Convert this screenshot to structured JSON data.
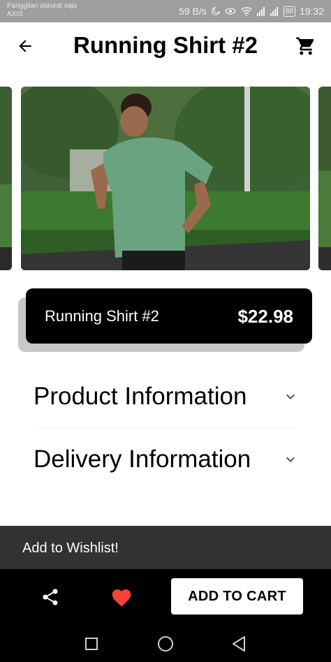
{
  "status_bar": {
    "carrier_line1": "Panggilan darurat saja",
    "carrier_line2": "AXIS",
    "net_speed": "59 B/s",
    "battery": "88",
    "time": "19:32"
  },
  "app_bar": {
    "title": "Running Shirt #2",
    "back_icon": "arrow-back-icon",
    "cart_icon": "shopping-cart-icon"
  },
  "product": {
    "name": "Running Shirt #2",
    "price": "$22.98"
  },
  "accordions": [
    {
      "label": "Product Information",
      "icon": "chevron-down-icon"
    },
    {
      "label": "Delivery Information",
      "icon": "chevron-down-icon"
    }
  ],
  "snackbar": {
    "message": "Add to Wishlist!"
  },
  "bottom_bar": {
    "share_icon": "share-icon",
    "wishlist_icon": "heart-icon",
    "add_to_cart_label": "ADD TO CART"
  },
  "colors": {
    "wishlist_heart": "#f44336",
    "card_background": "#000000",
    "snackbar_background": "#323232",
    "status_bar": "#9e9e9e"
  }
}
